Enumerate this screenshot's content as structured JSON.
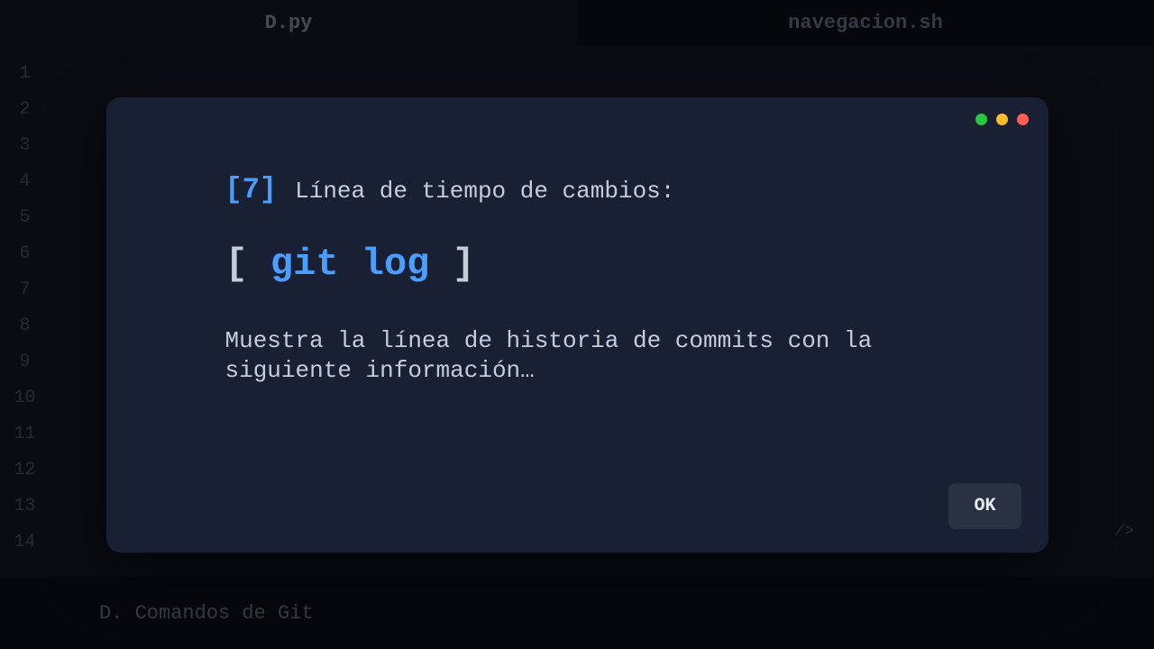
{
  "tabs": [
    {
      "label": "D.py",
      "active": true
    },
    {
      "label": "navegacion.sh",
      "active": false
    }
  ],
  "gutter": {
    "lines": [
      "1",
      "2",
      "3",
      "4",
      "5",
      "6",
      "7",
      "8",
      "9",
      "10",
      "11",
      "12",
      "13",
      "14"
    ]
  },
  "editor": {
    "close_tag": "/>"
  },
  "footer": {
    "text": "D. Comandos de Git"
  },
  "dialog": {
    "step_number": "[7]",
    "step_title": "Línea de tiempo de cambios:",
    "bracket_open": "[ ",
    "command": "git log",
    "bracket_close": " ]",
    "description": "Muestra la línea de historia de commits con la siguiente información…",
    "ok_label": "OK"
  },
  "colors": {
    "accent": "#4a9eff",
    "bg": "#0a0e1a",
    "panel": "#1a2033"
  }
}
